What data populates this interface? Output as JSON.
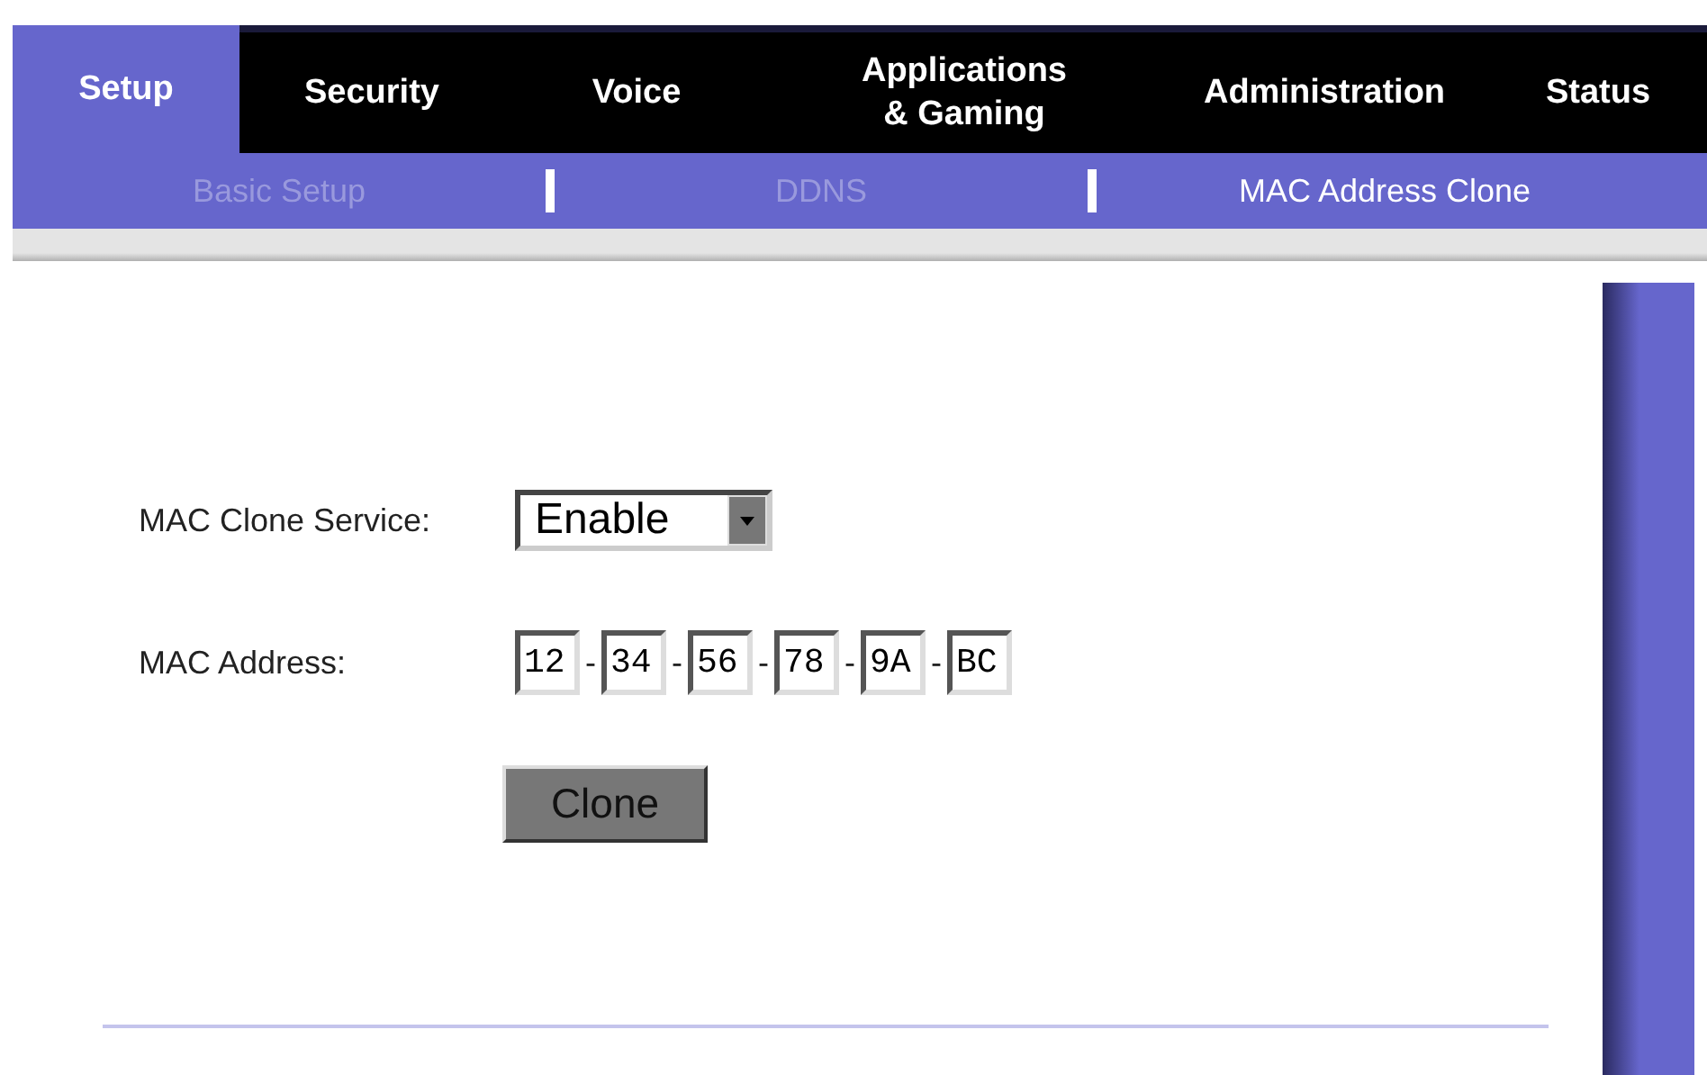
{
  "tabs": [
    {
      "label": "Setup",
      "selected": true
    },
    {
      "label": "Security",
      "selected": false
    },
    {
      "label": "Voice",
      "selected": false
    },
    {
      "label": "Applications\n& Gaming",
      "selected": false
    },
    {
      "label": "Administration",
      "selected": false
    },
    {
      "label": "Status",
      "selected": false
    }
  ],
  "subtabs": [
    {
      "label": "Basic Setup",
      "selected": false
    },
    {
      "label": "DDNS",
      "selected": false
    },
    {
      "label": "MAC Address Clone",
      "selected": true
    }
  ],
  "form": {
    "service_label": "MAC Clone Service:",
    "service_value": "Enable",
    "address_label": "MAC Address:",
    "octets": [
      "12",
      "34",
      "56",
      "78",
      "9A",
      "BC"
    ],
    "separator": "-",
    "clone_button": "Clone"
  }
}
